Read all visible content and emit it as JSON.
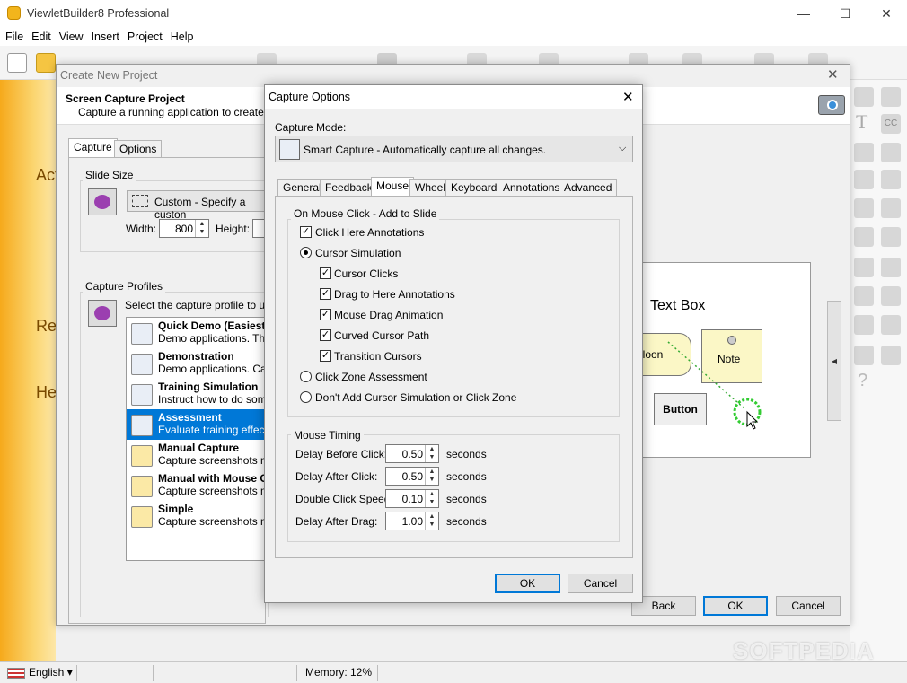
{
  "app": {
    "title": "ViewletBuilder8 Professional",
    "menu": [
      "File",
      "Edit",
      "View",
      "Insert",
      "Project",
      "Help"
    ],
    "left_labels": [
      "Act",
      "Re",
      "He"
    ],
    "status": {
      "language": "English",
      "memory": "Memory: 12%"
    },
    "watermark": "SOFTPEDIA"
  },
  "create_project": {
    "title": "Create New Project",
    "heading": "Screen Capture Project",
    "subheading": "Capture a running application to create a pr",
    "tabs": [
      "Capture",
      "Options"
    ],
    "slide_size": {
      "label": "Slide Size",
      "selected": "Custom - Specify a custon",
      "width_label": "Width:",
      "width_value": "800",
      "height_label": "Height:"
    },
    "capture_profiles": {
      "label": "Capture Profiles",
      "prompt": "Select the capture profile to use",
      "items": [
        {
          "name": "Quick Demo (Easiest)",
          "desc": "Demo applications. The e"
        },
        {
          "name": "Demonstration",
          "desc": "Demo applications. Captu"
        },
        {
          "name": "Training Simulation",
          "desc": "Instruct how to do some"
        },
        {
          "name": "Assessment",
          "desc": "Evaluate training effectiv"
        },
        {
          "name": "Manual Capture",
          "desc": "Capture screenshots ma"
        },
        {
          "name": "Manual with Mouse C",
          "desc": "Capture screenshots ma"
        },
        {
          "name": "Simple",
          "desc": "Capture screenshots ma"
        }
      ]
    },
    "preview": {
      "text_box": "Text Box",
      "balloon": "lloon",
      "note": "Note",
      "button": "Button"
    },
    "buttons": {
      "back": "Back",
      "ok": "OK",
      "cancel": "Cancel"
    }
  },
  "capture_options": {
    "title": "Capture Options",
    "mode_label": "Capture Mode:",
    "mode_value": "Smart Capture - Automatically capture all changes.",
    "tabs": [
      "General",
      "Feedback",
      "Mouse",
      "Wheel",
      "Keyboard",
      "Annotations",
      "Advanced"
    ],
    "on_click": {
      "label": "On Mouse Click - Add to Slide",
      "click_here": "Click Here Annotations",
      "cursor_sim": "Cursor Simulation",
      "sub": [
        "Cursor Clicks",
        "Drag to Here Annotations",
        "Mouse Drag Animation",
        "Curved Cursor Path",
        "Transition Cursors"
      ],
      "click_zone": "Click Zone Assessment",
      "dont_add": "Don't Add Cursor Simulation or Click Zone"
    },
    "timing": {
      "label": "Mouse Timing",
      "rows": [
        {
          "label": "Delay Before Click:",
          "value": "0.50",
          "unit": "seconds"
        },
        {
          "label": "Delay After Click:",
          "value": "0.50",
          "unit": "seconds"
        },
        {
          "label": "Double Click Speed:",
          "value": "0.10",
          "unit": "seconds"
        },
        {
          "label": "Delay After Drag:",
          "value": "1.00",
          "unit": "seconds"
        }
      ]
    },
    "buttons": {
      "ok": "OK",
      "cancel": "Cancel"
    }
  }
}
